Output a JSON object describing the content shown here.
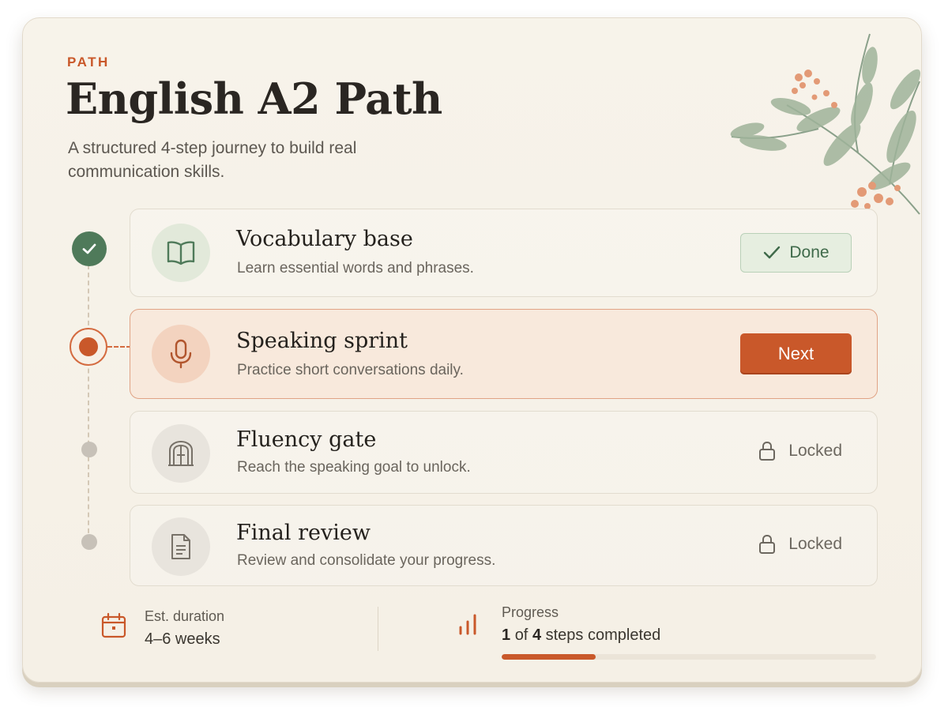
{
  "header": {
    "eyebrow": "PATH",
    "title": "English A2 Path",
    "subtitle": "A structured 4-step journey to build real communication skills."
  },
  "steps": [
    {
      "name": "Vocabulary base",
      "description": "Learn essential words and phrases.",
      "status": "done",
      "icon": "book-icon",
      "action_label": "Done"
    },
    {
      "name": "Speaking sprint",
      "description": "Practice short conversations daily.",
      "status": "current",
      "icon": "microphone-icon",
      "action_label": "Next"
    },
    {
      "name": "Fluency gate",
      "description": "Reach the speaking goal to unlock.",
      "status": "locked",
      "icon": "gate-icon",
      "action_label": "Locked"
    },
    {
      "name": "Final review",
      "description": "Review and consolidate your progress.",
      "status": "locked",
      "icon": "document-icon",
      "action_label": "Locked"
    }
  ],
  "footer": {
    "duration_label": "Est. duration",
    "duration_value": "4–6 weeks",
    "progress_label": "Progress",
    "progress_completed": "1",
    "progress_of": "of",
    "progress_total": "4",
    "progress_suffix": "steps completed",
    "progress_fraction": 0.25
  },
  "colors": {
    "accent": "#c9582a",
    "done_green": "#4f7a5a",
    "locked_gray": "#c7c1b8",
    "background": "#f6f1e7"
  }
}
